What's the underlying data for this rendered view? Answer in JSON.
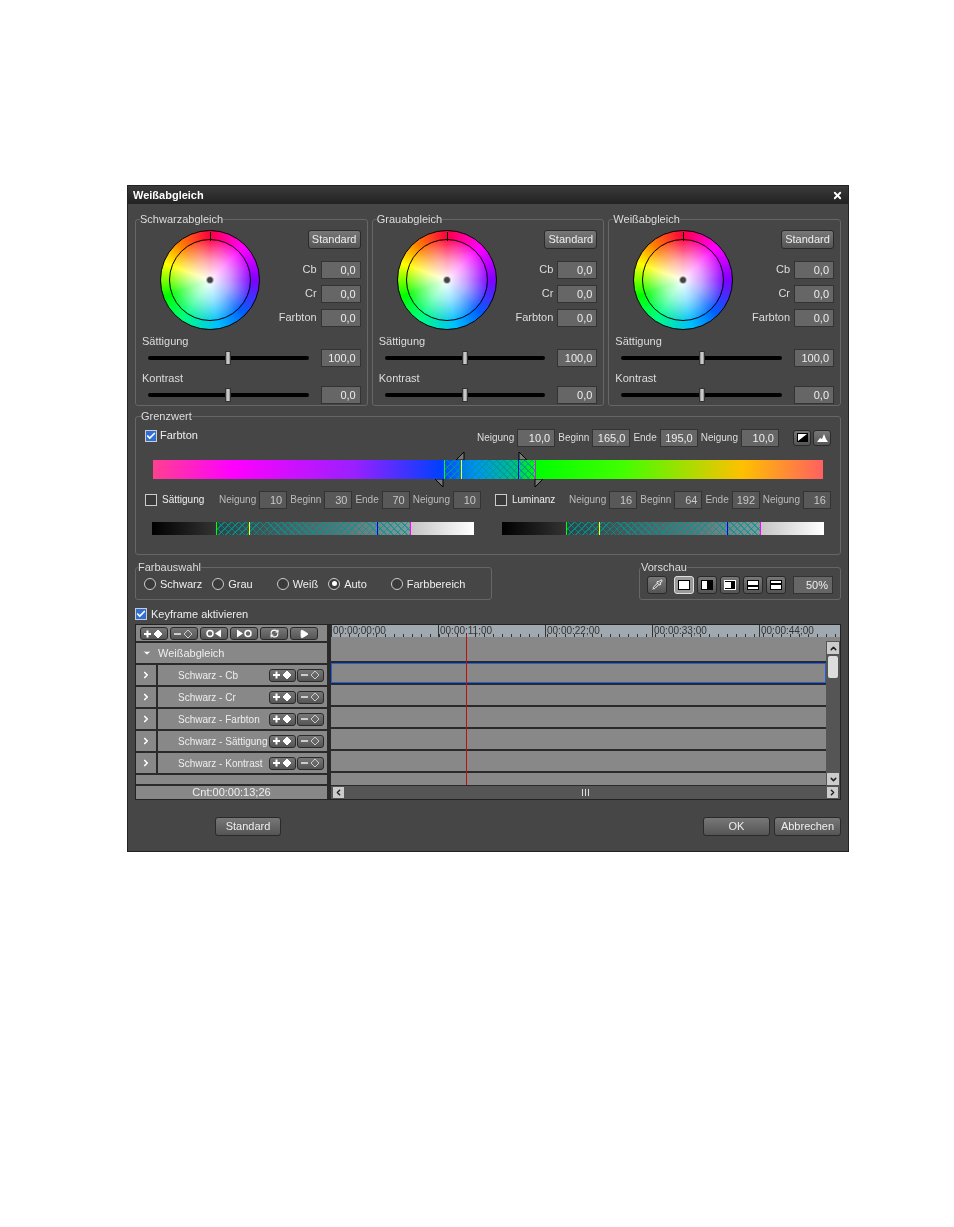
{
  "window": {
    "title": "Weißabgleich"
  },
  "balances": [
    {
      "title": "Schwarzabgleich",
      "button": "Standard",
      "fields": [
        {
          "label": "Cb",
          "value": "0,0"
        },
        {
          "label": "Cr",
          "value": "0,0"
        },
        {
          "label": "Farbton",
          "value": "0,0"
        }
      ],
      "sliders": [
        {
          "label": "Sättigung",
          "level": 0.5,
          "value": "100,0"
        },
        {
          "label": "Kontrast",
          "level": 0.5,
          "value": "0,0"
        }
      ]
    },
    {
      "title": "Grauabgleich",
      "button": "Standard",
      "fields": [
        {
          "label": "Cb",
          "value": "0,0"
        },
        {
          "label": "Cr",
          "value": "0,0"
        },
        {
          "label": "Farbton",
          "value": "0,0"
        }
      ],
      "sliders": [
        {
          "label": "Sättigung",
          "level": 0.5,
          "value": "100,0"
        },
        {
          "label": "Kontrast",
          "level": 0.5,
          "value": "0,0"
        }
      ]
    },
    {
      "title": "Weißabgleich",
      "button": "Standard",
      "fields": [
        {
          "label": "Cb",
          "value": "0,0"
        },
        {
          "label": "Cr",
          "value": "0,0"
        },
        {
          "label": "Farbton",
          "value": "0,0"
        }
      ],
      "sliders": [
        {
          "label": "Sättigung",
          "level": 0.5,
          "value": "100,0"
        },
        {
          "label": "Kontrast",
          "level": 0.5,
          "value": "0,0"
        }
      ]
    }
  ],
  "threshold": {
    "title": "Grenzwert",
    "hue": {
      "label": "Farbton",
      "checked": true,
      "fields": [
        {
          "label": "Neigung",
          "value": "10,0"
        },
        {
          "label": "Beginn",
          "value": "165,0"
        },
        {
          "label": "Ende",
          "value": "195,0"
        },
        {
          "label": "Neigung",
          "value": "10,0"
        }
      ]
    },
    "ranges": [
      {
        "label": "Sättigung",
        "checked": false,
        "fields": [
          {
            "label": "Neigung",
            "value": "10"
          },
          {
            "label": "Beginn",
            "value": "30"
          },
          {
            "label": "Ende",
            "value": "70"
          },
          {
            "label": "Neigung",
            "value": "10"
          }
        ]
      },
      {
        "label": "Luminanz",
        "checked": false,
        "fields": [
          {
            "label": "Neigung",
            "value": "16"
          },
          {
            "label": "Beginn",
            "value": "64"
          },
          {
            "label": "Ende",
            "value": "192"
          },
          {
            "label": "Neigung",
            "value": "16"
          }
        ]
      }
    ]
  },
  "color_selection": {
    "title": "Farbauswahl",
    "options": [
      {
        "label": "Schwarz",
        "selected": false
      },
      {
        "label": "Grau",
        "selected": false
      },
      {
        "label": "Weiß",
        "selected": false
      },
      {
        "label": "Auto",
        "selected": true
      },
      {
        "label": "Farbbereich",
        "selected": false
      }
    ]
  },
  "preview": {
    "title": "Vorschau",
    "modes": [
      {
        "kind": "pipette",
        "selected": false
      },
      {
        "kind": "full",
        "selected": true
      },
      {
        "kind": "split-left",
        "selected": false
      },
      {
        "kind": "split-right",
        "selected": false
      },
      {
        "kind": "split-top",
        "selected": false
      },
      {
        "kind": "split-bottom",
        "selected": false
      }
    ],
    "zoom": "50%"
  },
  "keyframe": {
    "label": "Keyframe aktivieren",
    "checked": true
  },
  "timeline": {
    "ruler": [
      "00:00:00;00",
      "00:00:11;00",
      "00:00:22;00",
      "00:00:33;00",
      "00:00:44;00"
    ],
    "group": {
      "label": "Weißabgleich",
      "expanded": true
    },
    "tracks": [
      {
        "label": "Schwarz - Cb",
        "selected": true
      },
      {
        "label": "Schwarz - Cr",
        "selected": false
      },
      {
        "label": "Schwarz - Farbton",
        "selected": false
      },
      {
        "label": "Schwarz - Sättigung",
        "selected": false
      },
      {
        "label": "Schwarz - Kontrast",
        "selected": false
      }
    ],
    "counter": "Cnt:00:00:13;26"
  },
  "buttons": {
    "reset": "Standard",
    "ok": "OK",
    "cancel": "Abbrechen"
  }
}
